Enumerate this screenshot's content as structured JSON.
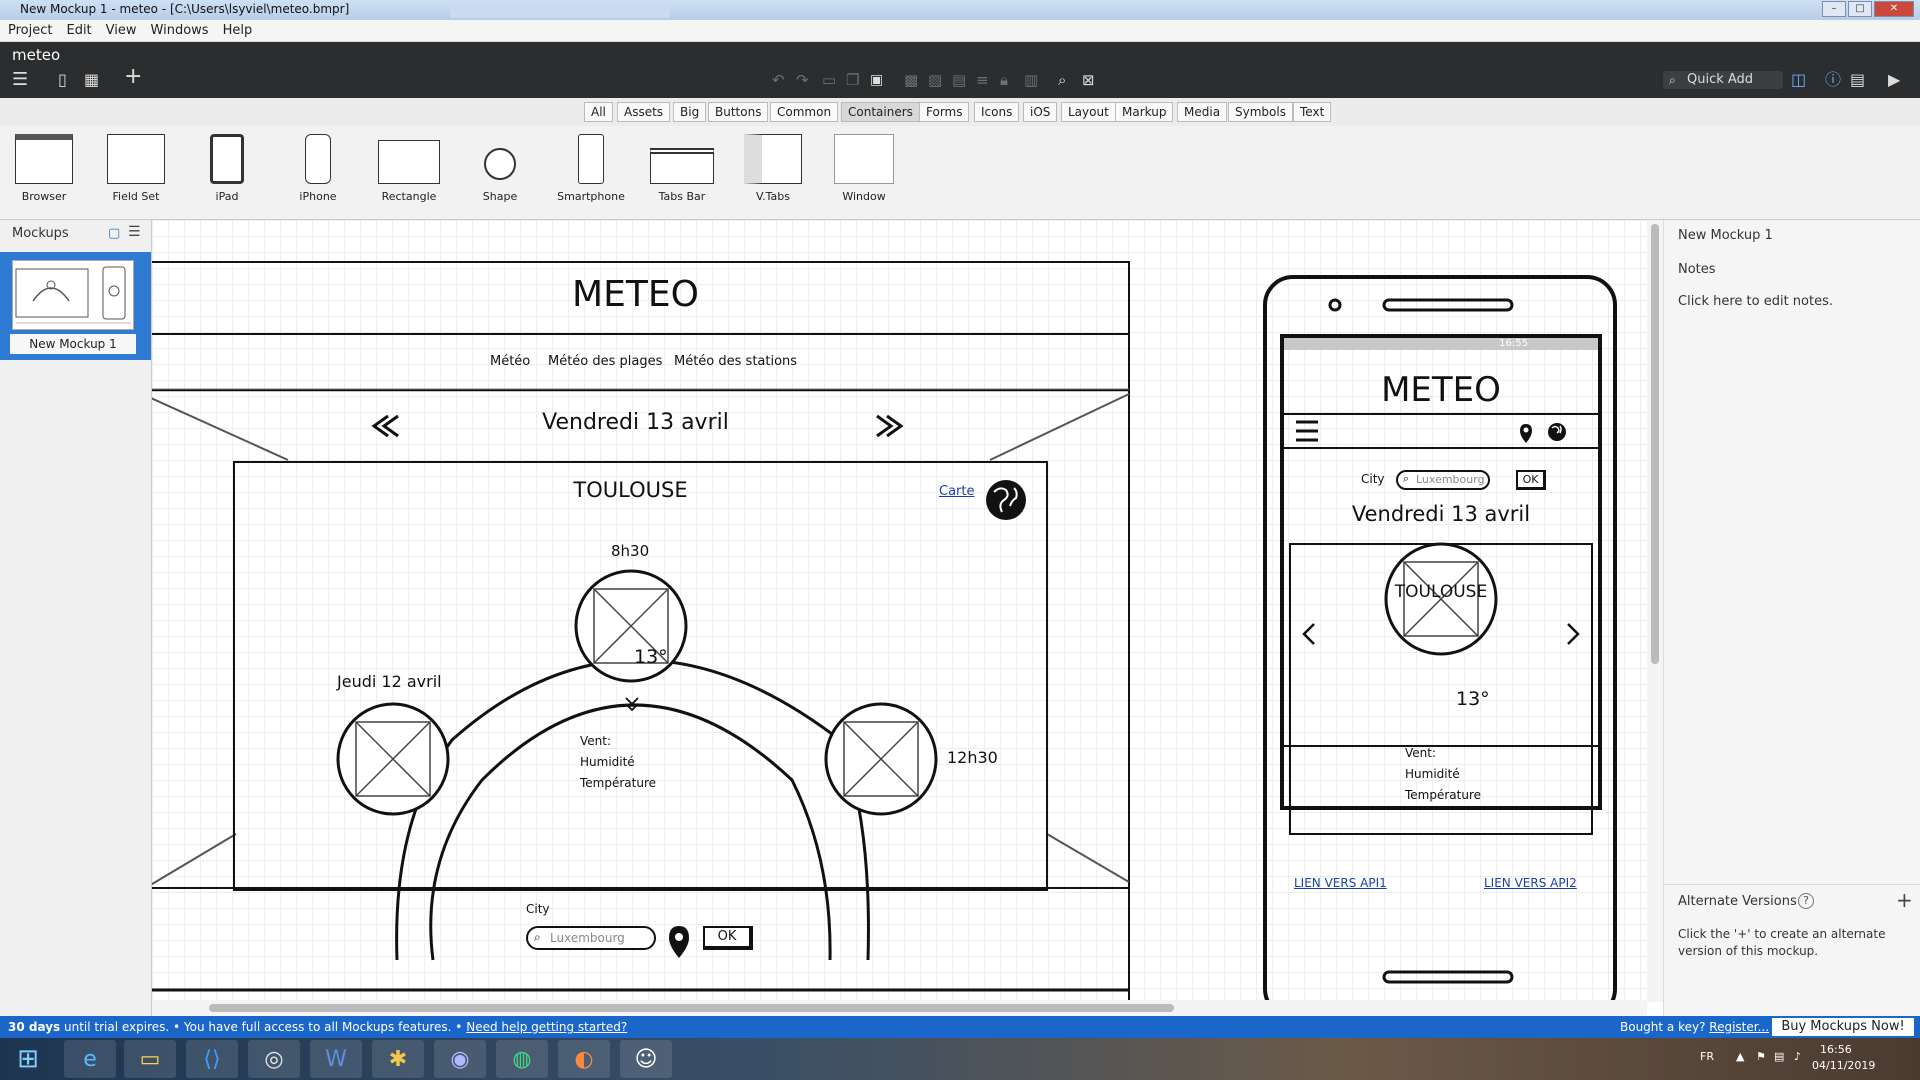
{
  "window": {
    "title": "New Mockup 1 - meteo - [C:\\Users\\lsyviel\\meteo.bmpr]"
  },
  "menu": [
    "Project",
    "Edit",
    "View",
    "Windows",
    "Help"
  ],
  "app": {
    "project_name": "meteo",
    "quick_add_placeholder": "Quick Add"
  },
  "library_tabs": [
    "All",
    "Assets",
    "Big",
    "Buttons",
    "Common",
    "Containers",
    "Forms",
    "Icons",
    "iOS",
    "Layout",
    "Markup",
    "Media",
    "Symbols",
    "Text"
  ],
  "library_active": "Containers",
  "components": [
    "Browser",
    "Field Set",
    "iPad",
    "iPhone",
    "Rectangle",
    "Shape",
    "Smartphone",
    "Tabs Bar",
    "V.Tabs",
    "Window"
  ],
  "mockups_panel": {
    "title": "Mockups",
    "items": [
      "New Mockup 1"
    ]
  },
  "desktop": {
    "title": "METEO",
    "nav": [
      "Météo",
      "Météo des plages",
      "Météo des stations"
    ],
    "date": "Vendredi 13 avril",
    "city": "TOULOUSE",
    "map_link": "Carte",
    "time_top": "8h30",
    "temp_top": "13°",
    "day_left": "Jeudi 12 avril",
    "time_right": "12h30",
    "details": [
      "Vent:",
      "Humidité",
      "Température"
    ],
    "city_label": "City",
    "city_placeholder": "Luxembourg",
    "ok": "OK"
  },
  "phone": {
    "status_time": "16:55",
    "title": "METEO",
    "city_label": "City",
    "city_placeholder": "Luxembourg",
    "ok": "OK",
    "date": "Vendredi 13 avril",
    "city": "TOULOUSE",
    "temp": "13°",
    "details": [
      "Vent:",
      "Humidité",
      "Température"
    ],
    "link1": "LIEN VERS API1",
    "link2": "LIEN VERS API2"
  },
  "inspector": {
    "mockup_title": "New Mockup 1",
    "notes_label": "Notes",
    "notes_hint": "Click here to edit notes.",
    "alt_title": "Alternate Versions",
    "alt_desc": "Click the '+' to create an alternate version of this mockup."
  },
  "trial": {
    "days": "30 days",
    "text1": "until trial expires.  •  You have full access to all Mockups features.  •",
    "help_link": "Need help getting started?",
    "bought": "Bought a key?",
    "register": "Register...",
    "buy": "Buy Mockups Now!"
  },
  "tray": {
    "lang": "FR",
    "time": "16:56",
    "date": "04/11/2019"
  }
}
